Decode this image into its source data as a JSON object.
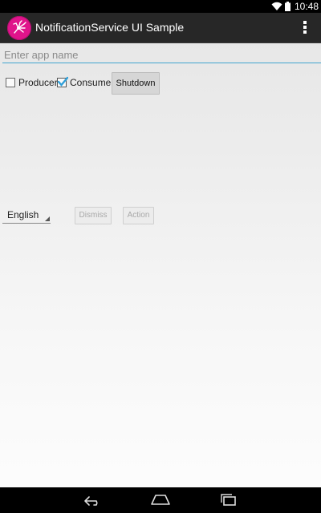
{
  "status_bar": {
    "time": "10:48",
    "icons": [
      "wifi-icon",
      "battery-icon"
    ]
  },
  "action_bar": {
    "title": "NotificationService UI Sample",
    "logo_icon": "app-logo-icon",
    "menu_icon": "overflow-menu-icon",
    "logo_color": "#e0148b"
  },
  "app_name_input": {
    "value": "",
    "placeholder": "Enter app name",
    "underline_color": "#40a4cf"
  },
  "roles": {
    "producer": {
      "label": "Producer",
      "checked": false
    },
    "consumer": {
      "label": "Consumer",
      "checked": true
    },
    "shutdown_label": "Shutdown"
  },
  "language": {
    "selected": "English"
  },
  "actions": {
    "dismiss_label": "Dismiss",
    "action_label": "Action"
  },
  "nav_bar": {
    "icons": [
      "back-icon",
      "home-icon",
      "recent-apps-icon"
    ]
  }
}
